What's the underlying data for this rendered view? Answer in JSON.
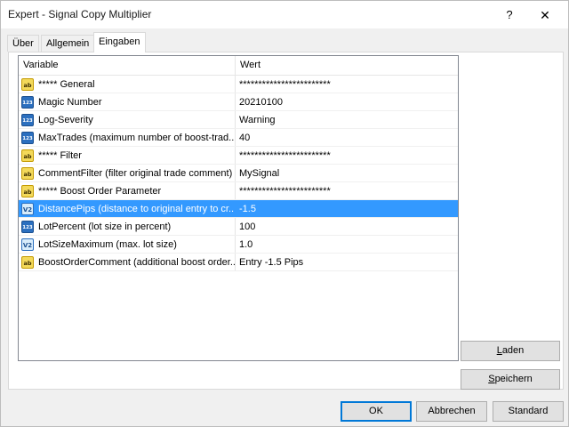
{
  "window": {
    "title": "Expert - Signal Copy Multiplier",
    "help_glyph": "?",
    "close_glyph": "✕"
  },
  "tabs": [
    {
      "label": "Über",
      "active": false
    },
    {
      "label": "Allgemein",
      "active": false
    },
    {
      "label": "Eingaben",
      "active": true
    }
  ],
  "grid": {
    "headers": {
      "variable": "Variable",
      "value": "Wert"
    },
    "rows": [
      {
        "icon": "ab",
        "variable": "***** General",
        "value": "************************",
        "selected": false
      },
      {
        "icon": "123",
        "variable": "Magic Number",
        "value": "20210100",
        "selected": false
      },
      {
        "icon": "123",
        "variable": "Log-Severity",
        "value": "Warning",
        "selected": false
      },
      {
        "icon": "123",
        "variable": "MaxTrades (maximum number of boost-trad...",
        "value": "40",
        "selected": false
      },
      {
        "icon": "ab",
        "variable": "***** Filter",
        "value": "************************",
        "selected": false
      },
      {
        "icon": "ab",
        "variable": "CommentFilter (filter original trade comment)",
        "value": "MySignal",
        "selected": false
      },
      {
        "icon": "ab",
        "variable": "***** Boost Order Parameter",
        "value": "************************",
        "selected": false
      },
      {
        "icon": "v2",
        "variable": "DistancePips (distance to original entry to cr...",
        "value": "-1.5",
        "selected": true
      },
      {
        "icon": "123",
        "variable": "LotPercent (lot size in percent)",
        "value": "100",
        "selected": false
      },
      {
        "icon": "v2",
        "variable": "LotSizeMaximum (max. lot size)",
        "value": "1.0",
        "selected": false
      },
      {
        "icon": "ab",
        "variable": "BoostOrderComment (additional boost order...",
        "value": "Entry -1.5 Pips",
        "selected": false
      }
    ]
  },
  "icon_glyphs": {
    "ab": "ab",
    "123": "123",
    "v2": "V2"
  },
  "buttons": {
    "load": {
      "underline": "L",
      "rest": "aden"
    },
    "save": {
      "underline": "S",
      "rest": "peichern"
    },
    "ok": "OK",
    "cancel": "Abbrechen",
    "default": "Standard"
  },
  "colors": {
    "selection": "#3399ff",
    "default_button_border": "#0078d7",
    "icon_string": "#f3d95a",
    "icon_integer": "#2b6fbf"
  }
}
